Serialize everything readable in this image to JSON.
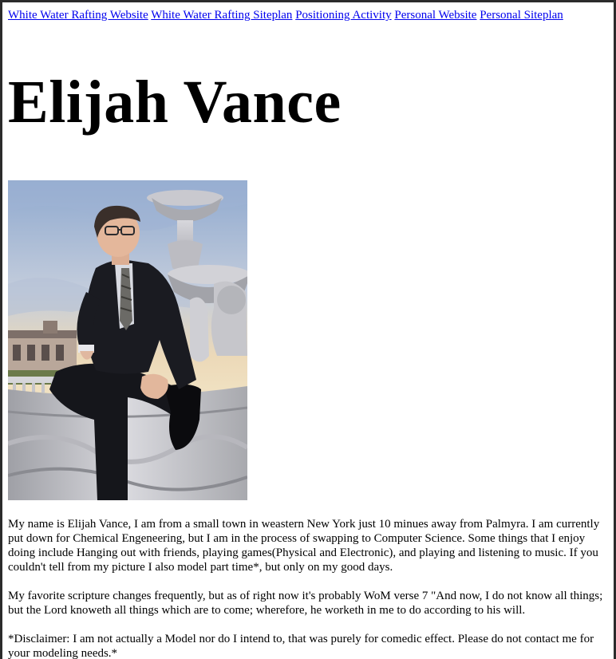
{
  "nav": {
    "links": [
      "White Water Rafting Website",
      "White Water Rafting Siteplan",
      "Positioning Activity",
      "Personal Website",
      "Personal Siteplan"
    ]
  },
  "page": {
    "title": "Elijah Vance"
  },
  "photo": {
    "alt": "Photo of Elijah Vance sitting on a fountain at sunset"
  },
  "paragraphs": [
    "My name is Elijah Vance, I am from a small town in weastern New York just 10 minues away from Palmyra. I am currently put down for Chemical Engeneering, but I am in the process of swapping to Computer Science. Some things that I enjoy doing include Hanging out with friends, playing games(Physical and Electronic), and playing and listening to music. If you couldn't tell from my picture I also model part time*, but only on my good days.",
    "My favorite scripture changes frequently, but as of right now it's probably WoM verse 7 \"And now, I do not know all things; but the Lord knoweth all things which are to come; wherefore, he worketh in me to do according to his will.",
    "*Disclaimer: I am not actually a Model nor do I intend to, that was purely for comedic effect. Please do not contact me for your modeling needs.*"
  ]
}
